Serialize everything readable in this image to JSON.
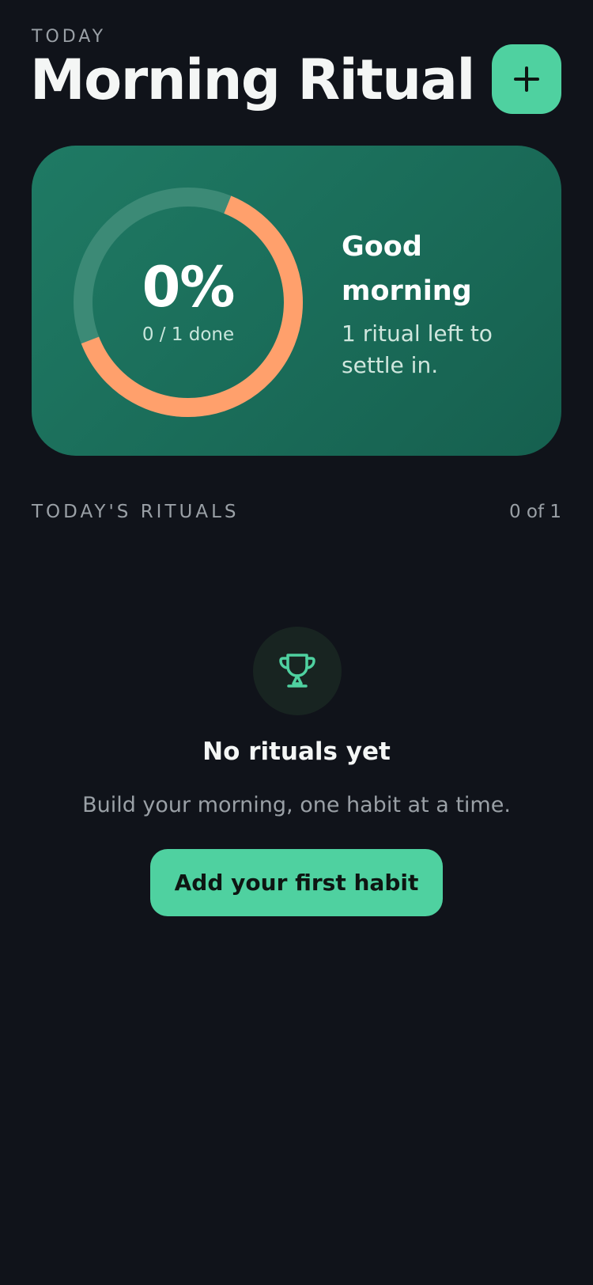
{
  "header": {
    "eyebrow": "TODAY",
    "title": "Morning Ritual",
    "add_button_icon": "plus-icon"
  },
  "progress_card": {
    "percent_label": "0%",
    "progress_fraction": 0.63,
    "done_label": "0 / 1 done",
    "greeting": "Good morning",
    "subtext": "1 ritual left to settle in.",
    "colors": {
      "ring_fill": "#ffa06c",
      "ring_track": "#3c8a76",
      "card_start": "#1f7a64",
      "card_end": "#16604f"
    }
  },
  "rituals_section": {
    "label": "TODAY'S RITUALS",
    "count": "0 of 1"
  },
  "empty_state": {
    "icon": "trophy-icon",
    "title": "No rituals yet",
    "subtitle": "Build your morning, one habit at a time.",
    "cta_label": "Add your first habit"
  },
  "colors": {
    "background": "#10131a",
    "accent": "#4fd1a0",
    "muted_text": "#9aa0a6"
  }
}
